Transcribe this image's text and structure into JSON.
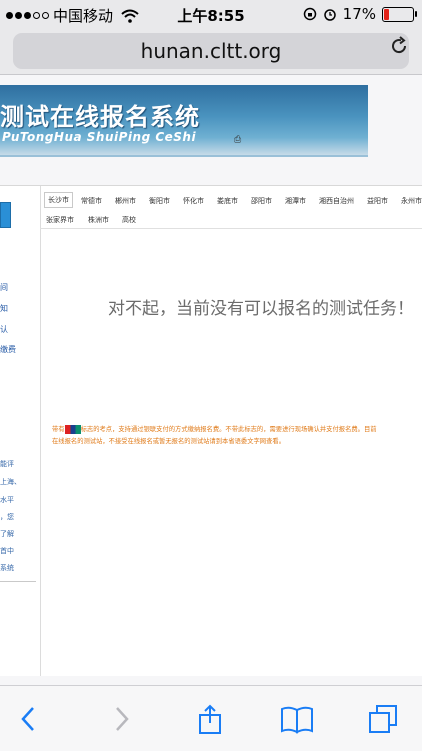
{
  "statusbar": {
    "carrier": "中国移动",
    "time": "上午8:55",
    "battery": "17%",
    "battery_level": 0.17
  },
  "browser": {
    "url": "hunan.cltt.org"
  },
  "banner": {
    "title": "测试在线报名系统",
    "subtitle": "PuTongHua ShuiPing CeShi"
  },
  "sidebar": {
    "items": [
      "间",
      "知",
      "认",
      "缴费"
    ],
    "text_lines": [
      "能评",
      "上海、",
      "水平",
      "，您",
      "了解",
      "首中",
      "系统"
    ]
  },
  "cities": {
    "row1": [
      "长沙市",
      "常德市",
      "郴州市",
      "衡阳市",
      "怀化市",
      "娄底市",
      "邵阳市",
      "湘潭市",
      "湘西自治州",
      "益阳市",
      "永州市"
    ],
    "row2": [
      "张家界市",
      "株洲市",
      "高校"
    ],
    "active": "长沙市"
  },
  "main": {
    "no_task_message": "对不起，当前没有可以报名的测试任务！",
    "notice_line1_prefix": "带有",
    "notice_line1_rest": "标志的考点，支持通过银联支付的方式缴纳报名费。不带此标志的，需要进行现场确认并支付报名费。目前",
    "notice_line2": "在线报名的测试站，不接受在线报名或暂无报名的测试站请到本省语委文字网查看。"
  },
  "toolbar": {
    "back": "back-icon",
    "forward": "forward-icon",
    "share": "share-icon",
    "bookmarks": "bookmarks-icon",
    "tabs": "tabs-icon"
  }
}
